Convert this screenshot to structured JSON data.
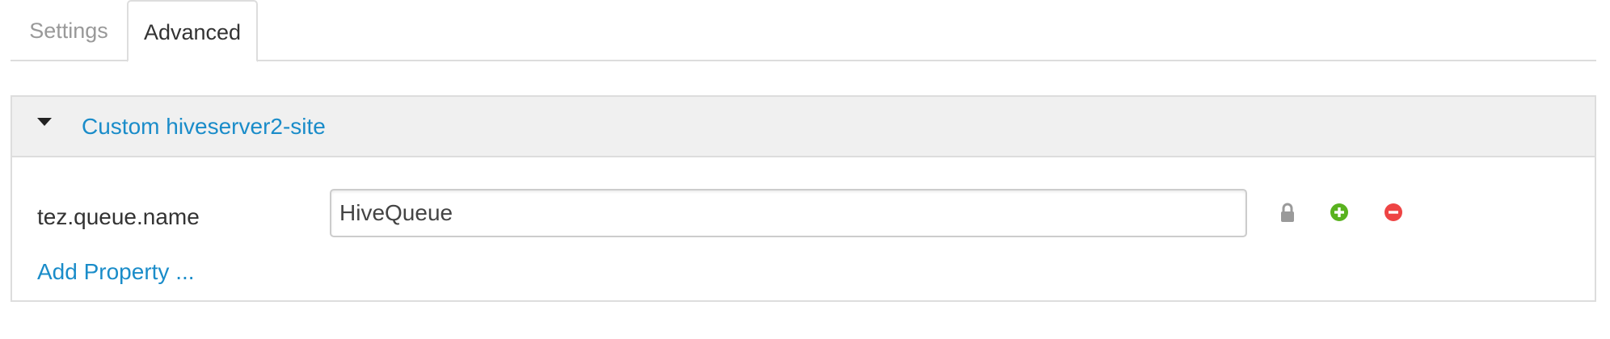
{
  "tabs": [
    {
      "label": "Settings",
      "active": false
    },
    {
      "label": "Advanced",
      "active": true
    }
  ],
  "section": {
    "title": "Custom hiveserver2-site",
    "expanded": true,
    "caret_icon": "caret-down-icon"
  },
  "property": {
    "name": "tez.queue.name",
    "value": "HiveQueue",
    "icons": [
      "lock-icon",
      "plus-circle-icon",
      "minus-circle-icon"
    ]
  },
  "add_property_label": "Add Property ...",
  "colors": {
    "link": "#1a8cc9",
    "add_green": "#59b21f",
    "remove_red": "#ee4444",
    "lock_gray": "#9a9a9a",
    "header_bg": "#f0f0f0",
    "border": "#dddddd"
  }
}
